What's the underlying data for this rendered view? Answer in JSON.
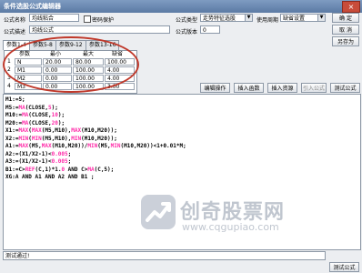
{
  "window": {
    "title": "条件选股公式编辑器",
    "close_label": "×"
  },
  "form": {
    "name_label": "公式名称",
    "name_value": "均线粘合",
    "password_label": "密码保护",
    "desc_label": "公式描述",
    "desc_value": "均线公式",
    "type_label": "公式类型",
    "type_value": "走势特征选股",
    "period_label": "使用周期",
    "period_value": "缺省设置",
    "version_label": "公式版本",
    "version_value": "0"
  },
  "buttons": {
    "ok": "确 定",
    "cancel": "取 消",
    "save_as": "另存为",
    "edit_ops": "编辑操作",
    "insert_func": "插入函数",
    "insert_resource": "插入资源",
    "import_formula": "引入公式",
    "test_formula": "测试公式",
    "bottom_test": "测试公式"
  },
  "tabs": [
    "参数1-4",
    "参数5-8",
    "参数9-12",
    "参数13-16"
  ],
  "params": {
    "headers": [
      "参数",
      "最小",
      "最大",
      "缺省"
    ],
    "rows": [
      {
        "num": "1",
        "name": "N",
        "min": "20.00",
        "max": "80.00",
        "def": "100.00"
      },
      {
        "num": "2",
        "name": "M1",
        "min": "0.00",
        "max": "100.00",
        "def": "4.00"
      },
      {
        "num": "3",
        "name": "M2",
        "min": "0.00",
        "max": "100.00",
        "def": "4.00"
      },
      {
        "num": "4",
        "name": "M3",
        "min": "0.00",
        "max": "100.00",
        "def": "3.00"
      }
    ]
  },
  "code_lines": [
    [
      {
        "t": "M1:=5;"
      }
    ],
    [
      {
        "t": "M5:="
      },
      {
        "t": "MA",
        "c": "fn"
      },
      {
        "t": "(CLOSE,"
      },
      {
        "t": "5",
        "c": "num"
      },
      {
        "t": ");"
      }
    ],
    [
      {
        "t": "M10:="
      },
      {
        "t": "MA",
        "c": "fn"
      },
      {
        "t": "(CLOSE,"
      },
      {
        "t": "10",
        "c": "num"
      },
      {
        "t": ");"
      }
    ],
    [
      {
        "t": "M20:="
      },
      {
        "t": "MA",
        "c": "fn"
      },
      {
        "t": "(CLOSE,"
      },
      {
        "t": "20",
        "c": "num"
      },
      {
        "t": ");"
      }
    ],
    [
      {
        "t": "X1:="
      },
      {
        "t": "MAX",
        "c": "fn"
      },
      {
        "t": "("
      },
      {
        "t": "MAX",
        "c": "fn"
      },
      {
        "t": "(M5,M10),"
      },
      {
        "t": "MAX",
        "c": "fn"
      },
      {
        "t": "(M10,M20));"
      }
    ],
    [
      {
        "t": "X2:="
      },
      {
        "t": "MIN",
        "c": "fn"
      },
      {
        "t": "("
      },
      {
        "t": "MIN",
        "c": "fn"
      },
      {
        "t": "(M5,M10),"
      },
      {
        "t": "MIN",
        "c": "fn"
      },
      {
        "t": "(M10,M20));"
      }
    ],
    [
      {
        "t": "A1:="
      },
      {
        "t": "MAX",
        "c": "fn"
      },
      {
        "t": "(M5,"
      },
      {
        "t": "MAX",
        "c": "fn"
      },
      {
        "t": "(M10,M20))/"
      },
      {
        "t": "MIN",
        "c": "fn"
      },
      {
        "t": "(M5,"
      },
      {
        "t": "MIN",
        "c": "fn"
      },
      {
        "t": "(M10,M20))<1+0.01*M;"
      }
    ],
    [
      {
        "t": "A2:=(X1/X2-1)<"
      },
      {
        "t": "0.005",
        "c": "num"
      },
      {
        "t": ";"
      }
    ],
    [
      {
        "t": "A3:=(X1/X2-1)<"
      },
      {
        "t": "0.005",
        "c": "num"
      },
      {
        "t": ";"
      }
    ],
    [
      {
        "t": "B1:=C>"
      },
      {
        "t": "REF",
        "c": "fn"
      },
      {
        "t": "(C,1)*1."
      },
      {
        "t": "0",
        "c": "num"
      },
      {
        "t": " AND C>"
      },
      {
        "t": "MA",
        "c": "fn"
      },
      {
        "t": "(C,5);"
      }
    ],
    [
      {
        "t": "XG:A AND A1 AND A2 AND B1 ;"
      }
    ]
  ],
  "status": {
    "text": "测试通过!"
  },
  "watermark": {
    "text": "创奇股票网",
    "url": "www.cqgupiao.com"
  },
  "colors": {
    "titlebar": "#5b7aa4",
    "highlight": "#c0392b",
    "keyword": "#ff2aa8"
  }
}
